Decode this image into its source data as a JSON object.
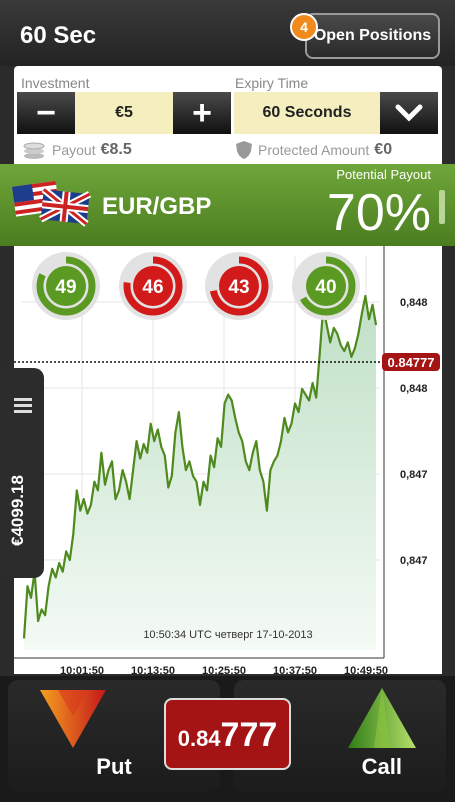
{
  "header": {
    "title": "60 Sec",
    "open_positions_label": "Open Positions",
    "open_positions_count": "4"
  },
  "investment": {
    "label": "Investment",
    "amount": "€5",
    "minus": "−",
    "plus": "+",
    "payout_label": "Payout",
    "payout_value": "€8.5"
  },
  "expiry": {
    "label": "Expiry Time",
    "value": "60 Seconds",
    "protected_label": "Protected Amount",
    "protected_value": "€0"
  },
  "asset": {
    "pair": "EUR/GBP",
    "potential_payout_label": "Potential Payout",
    "potential_payout_value": "70%"
  },
  "timers": [
    {
      "value": "49",
      "color": "#5a9a22",
      "fraction": 0.82
    },
    {
      "value": "46",
      "color": "#d21a1a",
      "fraction": 0.77
    },
    {
      "value": "43",
      "color": "#d21a1a",
      "fraction": 0.72
    },
    {
      "value": "40",
      "color": "#5a9a22",
      "fraction": 0.67
    }
  ],
  "balance": "€4099.18",
  "chart_data": {
    "type": "area",
    "x_ticks": [
      "10:01:50",
      "10:13:50",
      "10:25:50",
      "10:37:50",
      "10:49:50"
    ],
    "y_ticks": [
      "0,848",
      "0,848",
      "0,847",
      "0,847"
    ],
    "current_price_label": "0.84777",
    "timestamp": "10:50:34  UTC  четверг  17-10-2013",
    "line_color": "#4e8a1e",
    "series": [
      0.04,
      0.22,
      0.18,
      0.27,
      0.1,
      0.14,
      0.12,
      0.22,
      0.28,
      0.25,
      0.3,
      0.27,
      0.34,
      0.31,
      0.4,
      0.55,
      0.48,
      0.52,
      0.47,
      0.5,
      0.58,
      0.55,
      0.68,
      0.57,
      0.62,
      0.65,
      0.52,
      0.55,
      0.62,
      0.58,
      0.52,
      0.62,
      0.72,
      0.66,
      0.71,
      0.68,
      0.78,
      0.72,
      0.76,
      0.7,
      0.67,
      0.56,
      0.6,
      0.75,
      0.82,
      0.7,
      0.62,
      0.65,
      0.6,
      0.58,
      0.5,
      0.58,
      0.55,
      0.67,
      0.63,
      0.73,
      0.7,
      0.85,
      0.88,
      0.86,
      0.8,
      0.75,
      0.72,
      0.65,
      0.62,
      0.68,
      0.72,
      0.62,
      0.58,
      0.48,
      0.62,
      0.65,
      0.67,
      0.72,
      0.8,
      0.75,
      0.78,
      0.85,
      0.82,
      0.9,
      0.88,
      0.86,
      0.92,
      0.87,
      1.02,
      1.18,
      1.12,
      1.06,
      1.11,
      1.09,
      1.05,
      1.03,
      1.06,
      1.01,
      1.04,
      1.09,
      1.16,
      1.22,
      1.14,
      1.19,
      1.12
    ]
  },
  "bottom": {
    "put_label": "Put",
    "call_label": "Call",
    "price_prefix": "0.84",
    "price_suffix": "777"
  }
}
